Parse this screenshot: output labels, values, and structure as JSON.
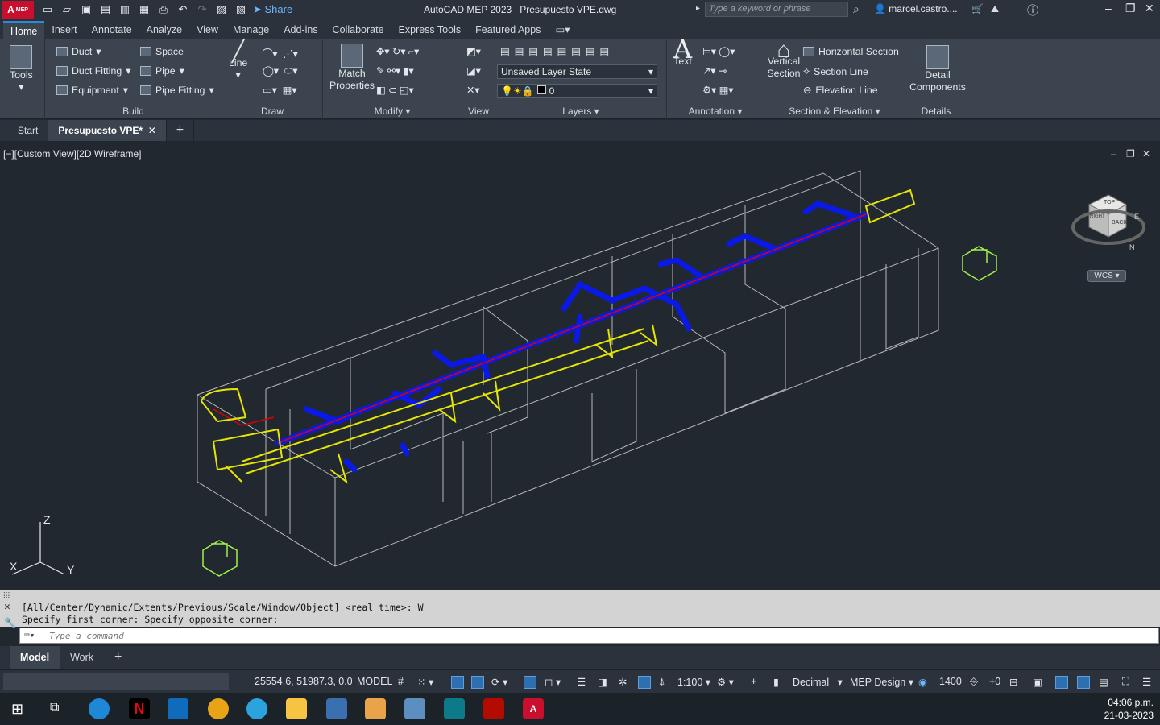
{
  "app": {
    "logo_text": "A",
    "logo_sub": "MEP",
    "title": "AutoCAD MEP 2023",
    "file": "Presupuesto VPE.dwg",
    "share_label": "Share",
    "search_placeholder": "Type a keyword or phrase",
    "user": "marcel.castro...."
  },
  "ribbon_tabs": [
    "Home",
    "Insert",
    "Annotate",
    "Analyze",
    "View",
    "Manage",
    "Add-ins",
    "Collaborate",
    "Express Tools",
    "Featured Apps"
  ],
  "ribbon": {
    "tools_label": "Tools",
    "build": {
      "label": "Build",
      "items": [
        "Duct",
        "Duct Fitting",
        "Equipment",
        "Space",
        "Pipe",
        "Pipe Fitting"
      ]
    },
    "draw": {
      "label": "Draw",
      "line": "Line"
    },
    "modify": {
      "label": "Modify",
      "match": "Match Properties"
    },
    "view": {
      "label": "View"
    },
    "layers": {
      "label": "Layers",
      "layer_state": "Unsaved Layer State",
      "layer": "0"
    },
    "annotation": {
      "label": "Annotation",
      "text": "Text"
    },
    "section": {
      "label": "Section & Elevation",
      "vertical": "Vertical Section",
      "items": [
        "Horizontal Section",
        "Section Line",
        "Elevation Line"
      ]
    },
    "details": {
      "label": "Details",
      "detail": "Detail Components"
    }
  },
  "doc_tabs": [
    "Start",
    "Presupuesto VPE*"
  ],
  "viewport": {
    "label": "[−][Custom View][2D Wireframe]",
    "viewcube_top": "TOP",
    "viewcube_back": "BACK",
    "viewcube_right": "RIGHT",
    "compass_e": "E",
    "compass_n": "N",
    "wcs": "WCS",
    "axis_x": "X",
    "axis_y": "Y",
    "axis_z": "Z"
  },
  "command": {
    "line1": "[All/Center/Dynamic/Extents/Previous/Scale/Window/Object] <real time>: W",
    "line2": "Specify first corner: Specify opposite corner:",
    "placeholder": "Type a command"
  },
  "layout_tabs": [
    "Model",
    "Work"
  ],
  "status": {
    "coords": "25554.6, 51987.3, 0.0",
    "model": "MODEL",
    "scale": "1:100",
    "units": "Decimal",
    "workspace": "MEP Design",
    "elevation": "1400",
    "offset": "+0"
  },
  "clock": {
    "time": "04:06 p.m.",
    "date": "21-03-2023"
  },
  "colors": {
    "accent": "#2a8cd8",
    "duct": "#0a19e6",
    "pipe": "#e6e600",
    "wire": "#b5b5b5",
    "center": "#e00000"
  }
}
